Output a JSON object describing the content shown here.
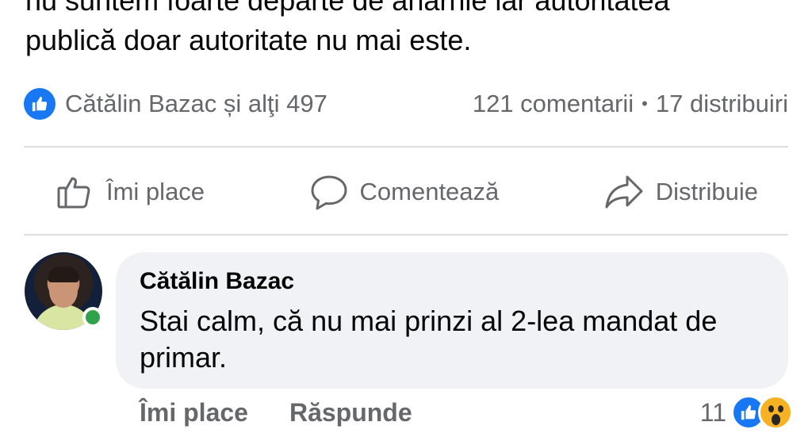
{
  "post": {
    "text_line1": "nu suntem foarte departe de anarhie iar autoritatea",
    "text_line2": "publică doar autoritate nu mai este."
  },
  "stats": {
    "reactors": "Cătălin Bazac și alţi 497",
    "comments": "121 comentarii",
    "separator": "•",
    "shares": "17 distribuiri"
  },
  "actions": {
    "like": "Îmi place",
    "comment": "Comentează",
    "share": "Distribuie"
  },
  "comment": {
    "author": "Cătălin Bazac",
    "text": "Stai calm, că nu mai prinzi al 2-lea mandat de primar.",
    "like_label": "Îmi place",
    "reply_label": "Răspunde",
    "reaction_count": "11",
    "reactions": [
      "like-icon",
      "wow-icon"
    ]
  },
  "colors": {
    "brand_blue": "#1877f2",
    "secondary_text": "#65676b",
    "bubble_bg": "#f0f2f5",
    "online_green": "#31a24c",
    "wow_yellow": "#f7b125"
  }
}
